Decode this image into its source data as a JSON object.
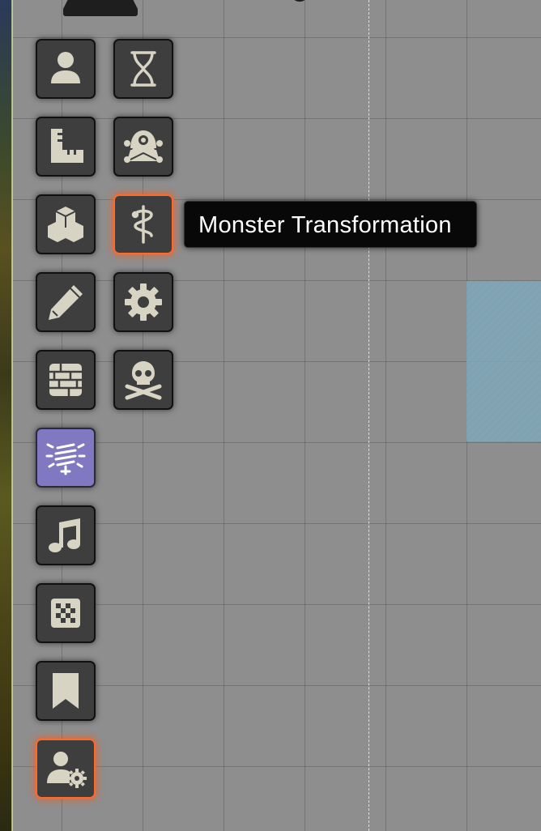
{
  "tooltip": {
    "text": "Monster Transformation"
  },
  "tools": [
    {
      "name": "token-controls",
      "icon": "person-icon",
      "state": "normal"
    },
    {
      "name": "combat-tracker",
      "icon": "hourglass-icon",
      "state": "normal"
    },
    {
      "name": "measurement-controls",
      "icon": "ruler-icon",
      "state": "normal"
    },
    {
      "name": "monster-tool",
      "icon": "monster-icon",
      "state": "normal"
    },
    {
      "name": "tile-controls",
      "icon": "cubes-icon",
      "state": "normal"
    },
    {
      "name": "monster-transformation",
      "icon": "caduceus-icon",
      "state": "hover"
    },
    {
      "name": "drawing-tools",
      "icon": "pencil-icon",
      "state": "normal"
    },
    {
      "name": "settings",
      "icon": "gear-icon",
      "state": "normal"
    },
    {
      "name": "wall-controls",
      "icon": "brick-wall-icon",
      "state": "normal"
    },
    {
      "name": "skull-tool",
      "icon": "skull-crossbones-icon",
      "state": "normal"
    },
    {
      "name": "lighting-controls",
      "icon": "lightbulb-icon",
      "state": "active"
    },
    {
      "name": "sound-controls",
      "icon": "music-note-icon",
      "state": "normal"
    },
    {
      "name": "region-controls",
      "icon": "checkerboard-icon",
      "state": "normal"
    },
    {
      "name": "journal-notes",
      "icon": "bookmark-icon",
      "state": "normal"
    },
    {
      "name": "user-config",
      "icon": "user-gear-icon",
      "state": "hover"
    }
  ],
  "colors": {
    "canvas": "#8e8e8e",
    "tool_bg": "#3e3e3e",
    "tool_active": "#8078c0",
    "hover_glow": "#ff6a2a",
    "icon": "#d8d4c4",
    "guide_line": "#dcf27a"
  }
}
